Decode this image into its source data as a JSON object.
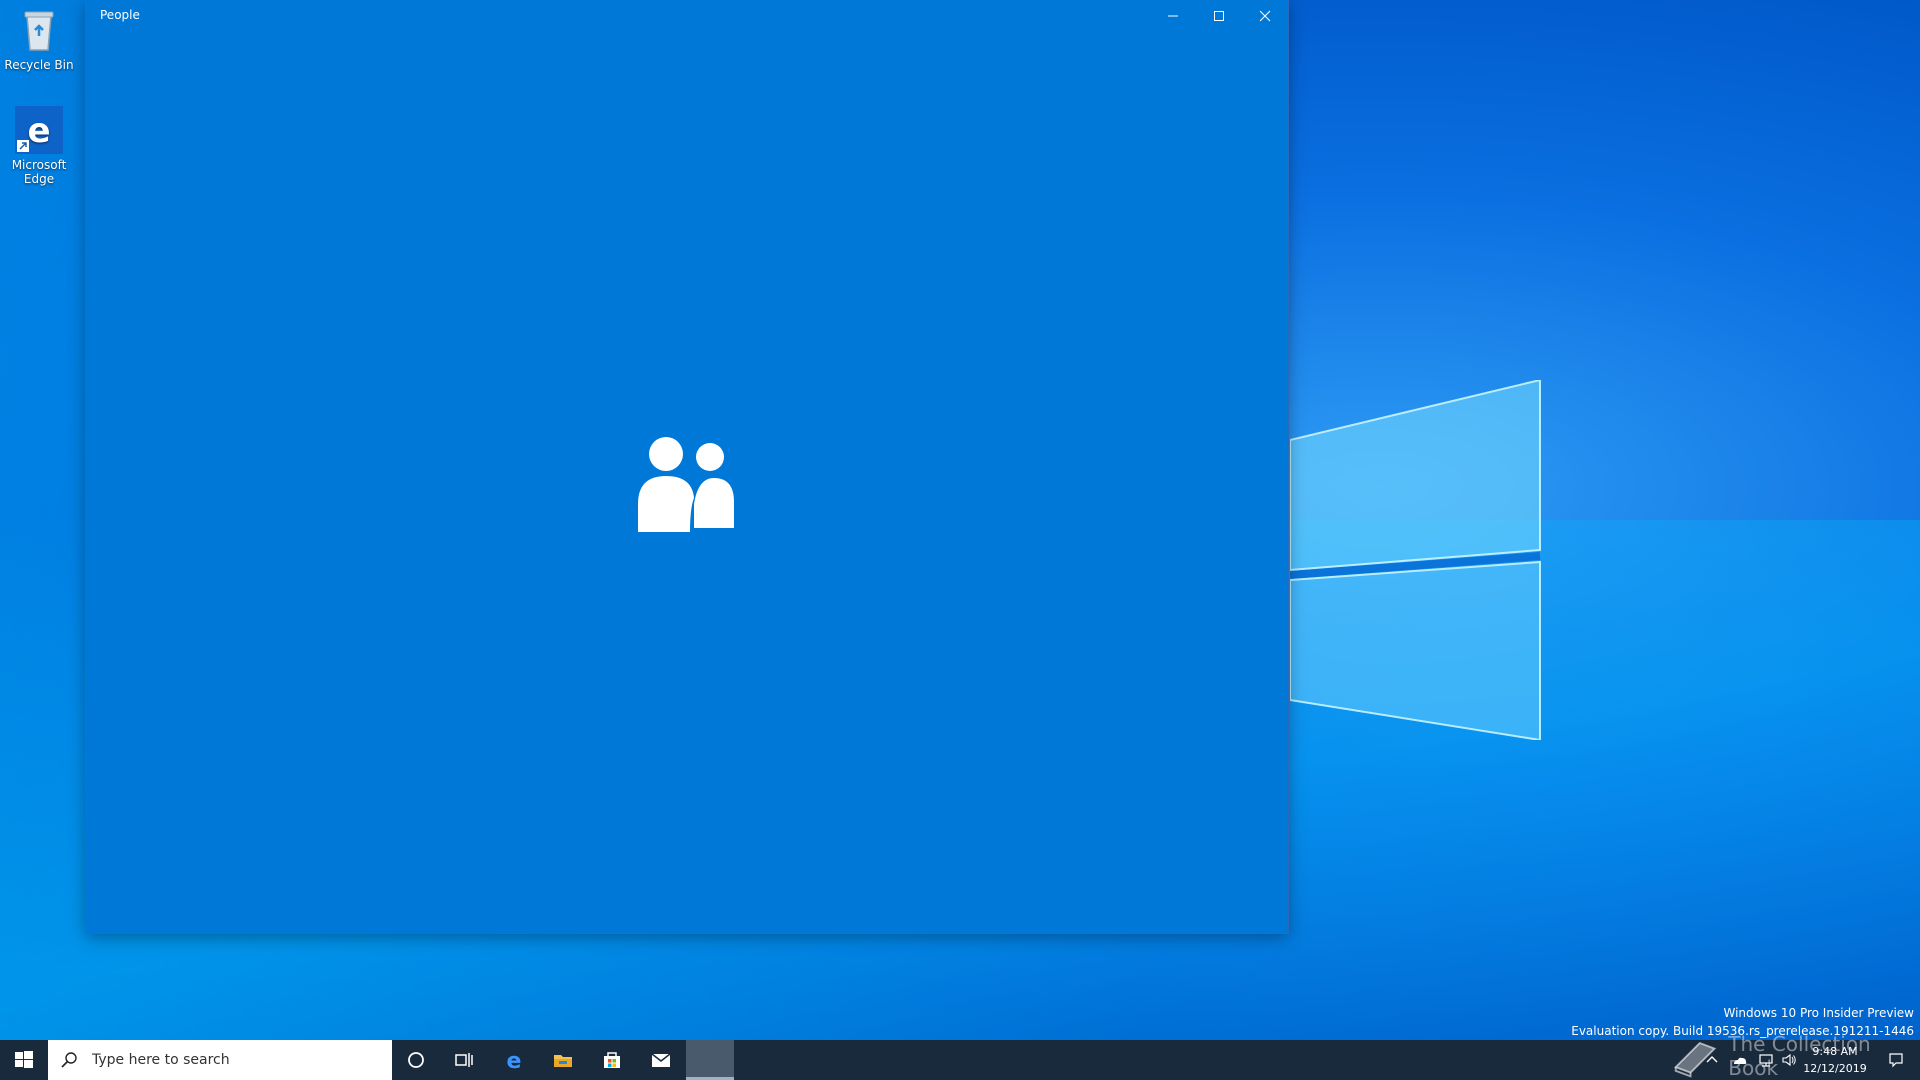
{
  "desktop": {
    "icons": [
      {
        "label": "Recycle Bin",
        "icon": "recycle-bin-icon"
      },
      {
        "label": "Microsoft Edge",
        "icon": "edge-icon"
      }
    ]
  },
  "window": {
    "title": "People",
    "controls": [
      "minimize-icon",
      "maximize-icon",
      "close-icon"
    ],
    "splash_icon": "people-icon",
    "background": "#0078d7"
  },
  "taskbar": {
    "search_placeholder": "Type here to search",
    "pinned": [
      "start-icon",
      "search-icon",
      "cortana-icon",
      "task-view-icon",
      "edge-icon",
      "file-explorer-icon",
      "store-icon",
      "mail-icon",
      "people-app-icon"
    ],
    "tray": [
      "chevron-up-icon",
      "onedrive-icon",
      "network-icon",
      "volume-icon"
    ],
    "clock_time": "9:48 AM",
    "clock_date": "12/12/2019",
    "background": "#1a2a3d"
  },
  "watermark": {
    "line1": "Windows 10 Pro Insider Preview",
    "line2": "Evaluation copy. Build 19536.rs_prerelease.191211-1446",
    "brand": "The Collection Book"
  }
}
